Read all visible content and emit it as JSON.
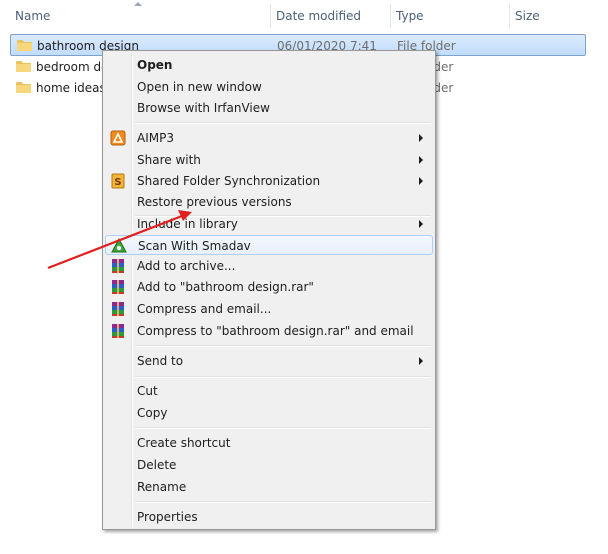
{
  "columns": {
    "name": "Name",
    "date_modified": "Date modified",
    "type": "Type",
    "size": "Size"
  },
  "files": [
    {
      "name": "bathroom design",
      "date": "06/01/2020 7:41",
      "type": "File folder",
      "selected": true
    },
    {
      "name": "bedroom de",
      "date": "",
      "type": "lder",
      "selected": false
    },
    {
      "name": "home ideas",
      "date": "",
      "type": "lder",
      "selected": false
    }
  ],
  "context_menu": {
    "items": [
      {
        "label": "Open"
      },
      {
        "label": "Open in new window"
      },
      {
        "label": "Browse with IrfanView"
      },
      {
        "label": "AIMP3",
        "icon": "aimp-icon"
      },
      {
        "label": "Share with"
      },
      {
        "label": "Shared Folder Synchronization",
        "icon": "sync-icon"
      },
      {
        "label": "Restore previous versions"
      },
      {
        "label": "Include in library"
      },
      {
        "label": "Scan With Smadav",
        "icon": "smadav-icon"
      },
      {
        "label": "Add to archive...",
        "icon": "winrar-icon"
      },
      {
        "label": "Add to \"bathroom design.rar\"",
        "icon": "winrar-icon"
      },
      {
        "label": "Compress and email...",
        "icon": "winrar-icon"
      },
      {
        "label": "Compress to \"bathroom design.rar\" and email",
        "icon": "winrar-icon"
      },
      {
        "label": "Send to"
      },
      {
        "label": "Cut"
      },
      {
        "label": "Copy"
      },
      {
        "label": "Create shortcut"
      },
      {
        "label": "Delete"
      },
      {
        "label": "Rename"
      },
      {
        "label": "Properties"
      }
    ]
  },
  "colors": {
    "selection": "#cce4fc",
    "annotation_arrow": "#e02020"
  }
}
